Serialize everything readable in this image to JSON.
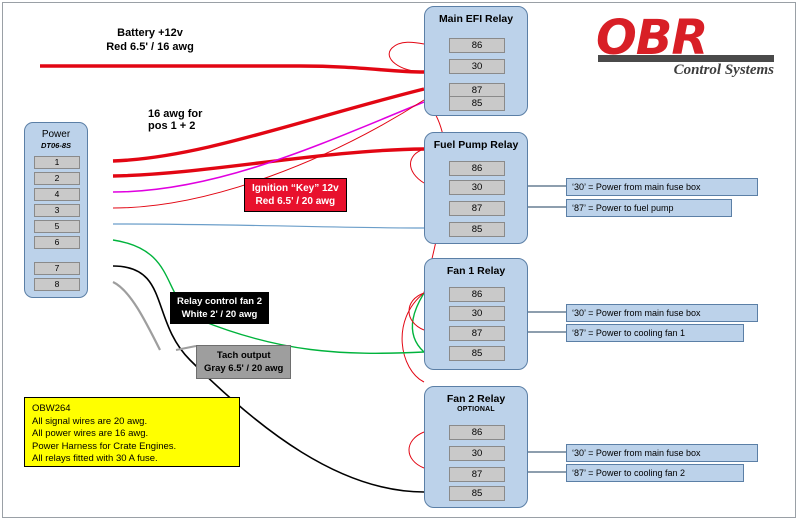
{
  "title": "OBR Control Systems Power Harness Wiring Diagram",
  "logo": {
    "brand": "OBR",
    "tagline": "Control Systems"
  },
  "labels": {
    "battery": "Battery +12v\nRed 6.5' / 16 awg",
    "battery_line1": "Battery +12v",
    "battery_line2": "Red 6.5' / 16 awg",
    "sixteen_awg": "16 awg for\npos 1 + 2",
    "sixteen_awg_line1": "16 awg for",
    "sixteen_awg_line2": "pos 1 + 2"
  },
  "tags": [
    {
      "name": "ignition-key",
      "line1": "Ignition “Key” 12v",
      "line2": "Red 6.5' / 20 awg",
      "style": "red"
    },
    {
      "name": "relay-control-fan-2",
      "line1": "Relay control fan 2",
      "line2": "White 2' / 20 awg",
      "style": "black"
    },
    {
      "name": "tach-output",
      "line1": "Tach output",
      "line2": "Gray 6.5' / 20 awg",
      "style": "gray"
    }
  ],
  "connector": {
    "title": "Power",
    "subtitle": "DT06-8S",
    "pins": [
      "1",
      "2",
      "4",
      "3",
      "5",
      "6",
      "7",
      "8"
    ]
  },
  "relays": [
    {
      "name": "main-efi-relay",
      "title": "Main EFI Relay",
      "subtitle": "",
      "pins": [
        "86",
        "30",
        "87",
        "85"
      ]
    },
    {
      "name": "fuel-pump-relay",
      "title": "Fuel Pump Relay",
      "subtitle": "",
      "pins": [
        "86",
        "30",
        "87",
        "85"
      ]
    },
    {
      "name": "fan-1-relay",
      "title": "Fan 1 Relay",
      "subtitle": "",
      "pins": [
        "86",
        "30",
        "87",
        "85"
      ]
    },
    {
      "name": "fan-2-relay",
      "title": "Fan 2 Relay",
      "subtitle": "OPTIONAL",
      "pins": [
        "86",
        "30",
        "87",
        "85"
      ]
    }
  ],
  "callouts": [
    {
      "name": "fuel-pump-30",
      "text": "‘30’ = Power from main fuse box"
    },
    {
      "name": "fuel-pump-87",
      "text": "‘87’ = Power to fuel pump"
    },
    {
      "name": "fan1-30",
      "text": "‘30’ = Power from main fuse box"
    },
    {
      "name": "fan1-87",
      "text": "‘87’ = Power to cooling fan 1"
    },
    {
      "name": "fan2-30",
      "text": "‘30’ = Power from main fuse box"
    },
    {
      "name": "fan2-87",
      "text": "‘87’ = Power to cooling fan 2"
    }
  ],
  "note": {
    "part_number": "OBW264",
    "lines": [
      "OBW264",
      "All signal wires are 20 awg.",
      "All power wires are 16 awg.",
      "Power Harness for Crate Engines.",
      "All relays fitted with 30 A fuse."
    ]
  },
  "colors": {
    "relay_fill": "#bcd2ea",
    "relay_stroke": "#5b7fa6",
    "pin_fill": "#c9c9c9",
    "note_fill": "#ffff00",
    "red": "#e8112d",
    "wire_red": "#e20613",
    "wire_magenta": "#e000e0",
    "wire_green": "#00b33c",
    "wire_black": "#000000",
    "wire_gray": "#9e9e9e",
    "wire_blue": "#6b9ec9",
    "logo_red": "#d81f26"
  }
}
